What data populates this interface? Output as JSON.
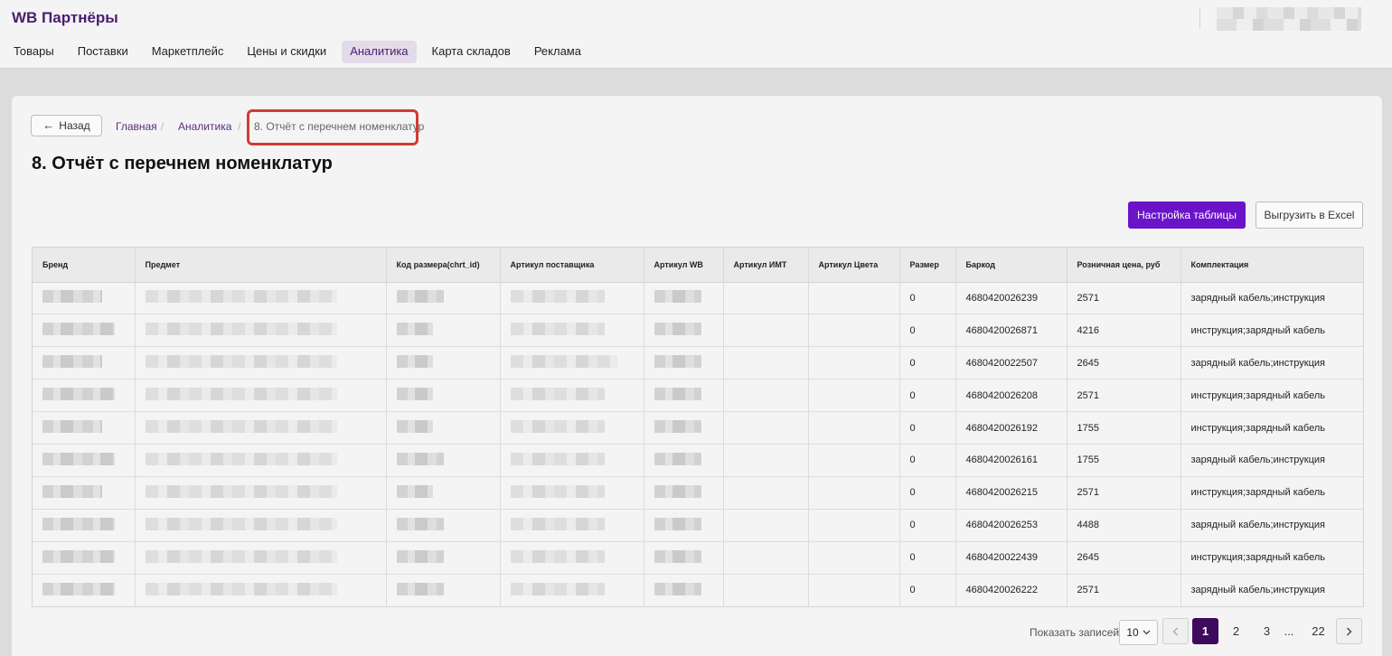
{
  "header": {
    "logo": "WB Партнёры",
    "nav": [
      "Товары",
      "Поставки",
      "Маркетплейс",
      "Цены и скидки",
      "Аналитика",
      "Карта складов",
      "Реклама"
    ],
    "active_nav": "Аналитика"
  },
  "breadcrumb": {
    "back_label": "Назад",
    "home": "Главная",
    "section": "Аналитика",
    "current": "8. Отчёт с перечнем номенклатур",
    "separator": "/"
  },
  "page": {
    "title": "8. Отчёт с перечнем номенклатур",
    "settings_button": "Настройка таблицы",
    "export_button": "Выгрузить в Excel"
  },
  "table": {
    "columns": [
      "Бренд",
      "Предмет",
      "Код размера(chrt_id)",
      "Артикул поставщика",
      "Артикул WB",
      "Артикул ИМТ",
      "Артикул Цвета",
      "Размер",
      "Баркод",
      "Розничная цена, руб",
      "Комплектация"
    ],
    "rows": [
      {
        "size": "0",
        "barcode": "4680420026239",
        "price": "2571",
        "kit": "зарядный кабель;инструкция"
      },
      {
        "size": "0",
        "barcode": "4680420026871",
        "price": "4216",
        "kit": "инструкция;зарядный кабель"
      },
      {
        "size": "0",
        "barcode": "4680420022507",
        "price": "2645",
        "kit": "зарядный кабель;инструкция"
      },
      {
        "size": "0",
        "barcode": "4680420026208",
        "price": "2571",
        "kit": "инструкция;зарядный кабель"
      },
      {
        "size": "0",
        "barcode": "4680420026192",
        "price": "1755",
        "kit": "инструкция;зарядный кабель"
      },
      {
        "size": "0",
        "barcode": "4680420026161",
        "price": "1755",
        "kit": "зарядный кабель;инструкция"
      },
      {
        "size": "0",
        "barcode": "4680420026215",
        "price": "2571",
        "kit": "инструкция;зарядный кабель"
      },
      {
        "size": "0",
        "barcode": "4680420026253",
        "price": "4488",
        "kit": "зарядный кабель;инструкция"
      },
      {
        "size": "0",
        "barcode": "4680420022439",
        "price": "2645",
        "kit": "инструкция;зарядный кабель"
      },
      {
        "size": "0",
        "barcode": "4680420026222",
        "price": "2571",
        "kit": "зарядный кабель;инструкция"
      }
    ]
  },
  "pagination": {
    "label": "Показать записей",
    "page_size": "10",
    "pages": [
      "1",
      "2",
      "3",
      "...",
      "22"
    ],
    "current": "1"
  },
  "colors": {
    "brand": "#4a1d6e",
    "accent": "#6b13c9",
    "active_page": "#3e0a5e",
    "highlight": "#d23a33"
  },
  "icons": {
    "back": "arrow-left-icon",
    "select": "chevron-down-icon",
    "prev": "chevron-left-icon",
    "next": "chevron-right-icon"
  }
}
